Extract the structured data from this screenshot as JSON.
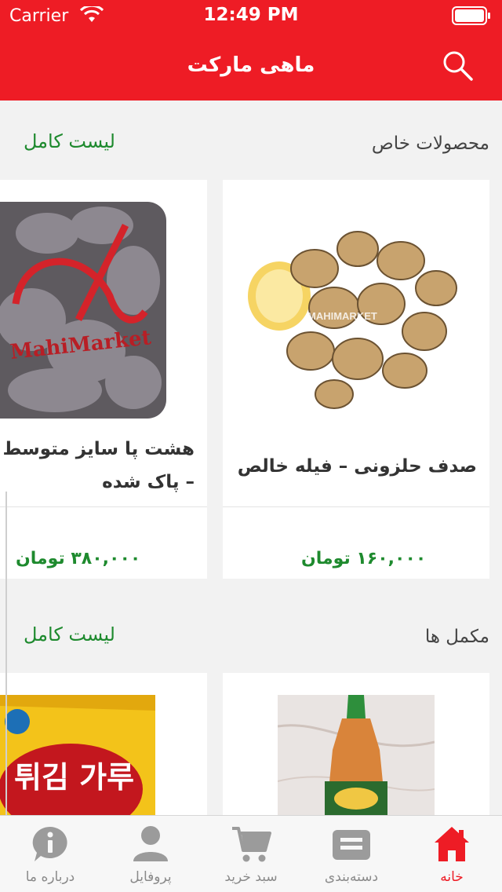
{
  "status_bar": {
    "carrier": "Carrier",
    "time": "12:49 PM"
  },
  "header": {
    "title": "ماهی مارکت"
  },
  "sections": [
    {
      "title": "محصولات خاص",
      "full_list_label": "لیست کامل",
      "products": [
        {
          "name": "صدف حلزونی – فیله خالص",
          "price": "۱۶۰,۰۰۰ تومان",
          "watermark": "MAHIMARKET"
        },
        {
          "name": "هشت پا سایز متوسط – پاک شده",
          "price": "۳۸۰,۰۰۰ تومان",
          "watermark": "MahiMarket"
        }
      ]
    },
    {
      "title": "مکمل ها",
      "full_list_label": "لیست کامل",
      "products": [
        {
          "name": "",
          "price": ""
        },
        {
          "name": "",
          "price": "",
          "package_text": "튀김 가루"
        }
      ]
    }
  ],
  "tabs": [
    {
      "label": "خانه",
      "icon": "home-icon",
      "active": true
    },
    {
      "label": "دسته‌بندی",
      "icon": "category-icon",
      "active": false
    },
    {
      "label": "سبد خرید",
      "icon": "cart-icon",
      "active": false
    },
    {
      "label": "پروفایل",
      "icon": "profile-icon",
      "active": false
    },
    {
      "label": "درباره ما",
      "icon": "info-icon",
      "active": false
    }
  ],
  "colors": {
    "brand": "#ee1c25",
    "price": "#1e8a2e",
    "background": "#f2f2f2"
  }
}
